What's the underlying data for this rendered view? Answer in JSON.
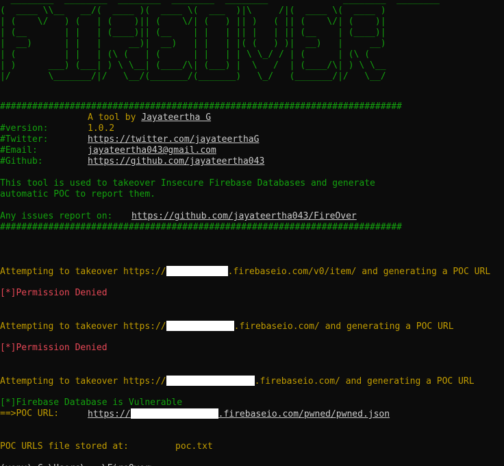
{
  "banner": [
    "(  ____ \\\\__   __/(  ____ )(  ____ \\(  ___  )|\\     /|(  ____ \\(  ____ )",
    "| (    \\/   ) (   | (    )|| (    \\/| (   ) || )   ( || (    \\/| (    )|",
    "| (__       | |   | (____)|| (__    | |   | || |   | || (__    | (____)|",
    "|  __)      | |   |     __)|  __)   | |   | |( (   ) )|  __)   |     __)",
    "| (         | |   | (\\ (   | (      | |   | | \\ \\_/ / | (      | (\\ (   ",
    "| )      ___) (___| ) \\ \\__| (____/\\| (___) |  \\   /  | (____/\\| ) \\ \\__",
    "|/       \\_______/|/   \\__/(_______/(_______)   \\_/   (_______/|/   \\__/"
  ],
  "hash_line": "###########################################################################",
  "info": {
    "tool_prefix": "A tool by ",
    "tool_author": "Jayateertha G",
    "version_label": "#version:",
    "version_value": "1.0.2",
    "twitter_label": "#Twitter:",
    "twitter_value": "https://twitter.com/jayateerthaG",
    "email_label": "#Email:",
    "email_value": "jayateertha043@gmail.com",
    "github_label": "#Github:",
    "github_value": "https://github.com/jayateertha043"
  },
  "description": [
    "This tool is used to takeover Insecure Firebase Databases and generate",
    "automatic POC to report them."
  ],
  "issues": {
    "label": "Any issues report on:",
    "url": "https://github.com/jayateertha043/FireOver"
  },
  "attempts": [
    {
      "prefix": "Attempting to takeover https://",
      "suffix": ".firebaseio.com/v0/item/ and generating a POC URL",
      "result": "[*]Permission Denied"
    },
    {
      "prefix": "Attempting to takeover https://",
      "suffix": ".firebaseio.com/ and generating a POC URL",
      "result": "[*]Permission Denied"
    },
    {
      "prefix": "Attempting to takeover https://",
      "suffix": ".firebaseio.com/ and generating a POC URL",
      "result": "[*]Firebase Database is Vulnerable"
    }
  ],
  "poc": {
    "label": "==>POC URL:",
    "url_prefix": "https://",
    "url_suffix": ".firebaseio.com/pwned/pwned.json"
  },
  "stored": {
    "label": "POC URLS file stored at:",
    "value": "poc.txt"
  },
  "colors": {
    "background": "#0c0c0c",
    "green": "#13a10e",
    "yellow": "#c19c00",
    "red": "#e74856",
    "white": "#cccccc",
    "redaction": "#ffffff"
  }
}
